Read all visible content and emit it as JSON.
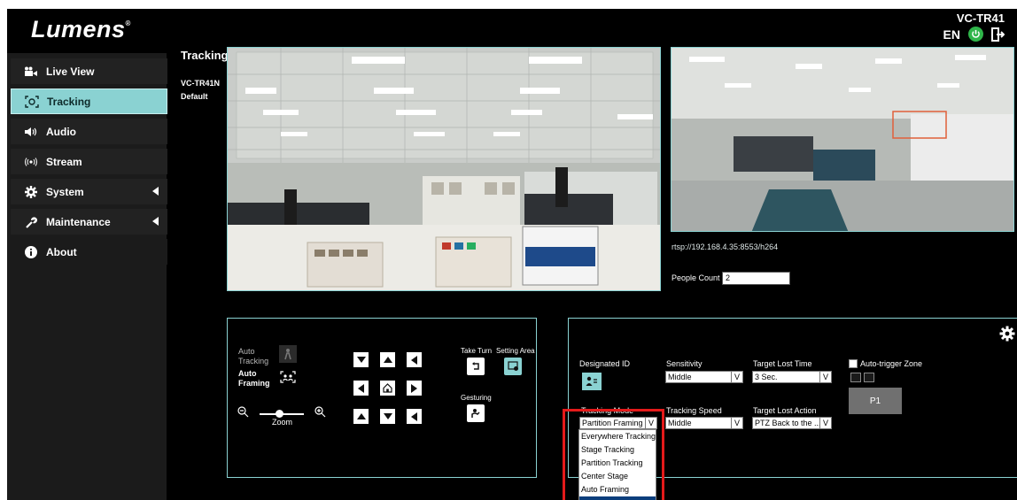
{
  "header": {
    "logo": "Lumens",
    "logo_mark": "®",
    "model": "VC-TR41",
    "language": "EN"
  },
  "sidebar": {
    "items": [
      {
        "label": "Live View",
        "icon": "camera-icon"
      },
      {
        "label": "Tracking",
        "icon": "tracking-icon",
        "active": true
      },
      {
        "label": "Audio",
        "icon": "speaker-icon"
      },
      {
        "label": "Stream",
        "icon": "stream-icon"
      },
      {
        "label": "System",
        "icon": "gear-icon",
        "expandable": true
      },
      {
        "label": "Maintenance",
        "icon": "wrench-icon",
        "expandable": true
      },
      {
        "label": "About",
        "icon": "info-icon"
      }
    ]
  },
  "main": {
    "title": "Tracking",
    "model": "VC-TR41N",
    "profile": "Default",
    "rtsp_url": "rtsp://192.168.4.35:8553/h264",
    "people_count_label": "People Count",
    "people_count_value": "2"
  },
  "ptz": {
    "auto_tracking_label": "Auto Tracking",
    "auto_framing_label": "Auto Framing",
    "zoom_label": "Zoom",
    "take_turn_label": "Take Turn",
    "setting_area_label": "Setting Area",
    "gesturing_label": "Gesturing"
  },
  "settings": {
    "designated_id_label": "Designated ID",
    "sensitivity_label": "Sensitivity",
    "sensitivity_value": "Middle",
    "target_lost_time_label": "Target Lost Time",
    "target_lost_time_value": "3 Sec.",
    "auto_trigger_label": "Auto-trigger Zone",
    "p1_label": "P1",
    "tracking_mode_label": "Tracking Mode",
    "tracking_mode_value": "Partition Framing",
    "tracking_speed_label": "Tracking Speed",
    "tracking_speed_value": "Middle",
    "target_lost_action_label": "Target Lost Action",
    "target_lost_action_value": "PTZ Back to the ...",
    "dropdown_arrow": "V",
    "tracking_mode_options": [
      "Everywhere Tracking",
      "Stage Tracking",
      "Partition Tracking",
      "Center Stage",
      "Auto Framing"
    ]
  },
  "colors": {
    "accent": "#8ad2d2",
    "highlight": "#e41a1a",
    "power": "#2fb54a"
  }
}
